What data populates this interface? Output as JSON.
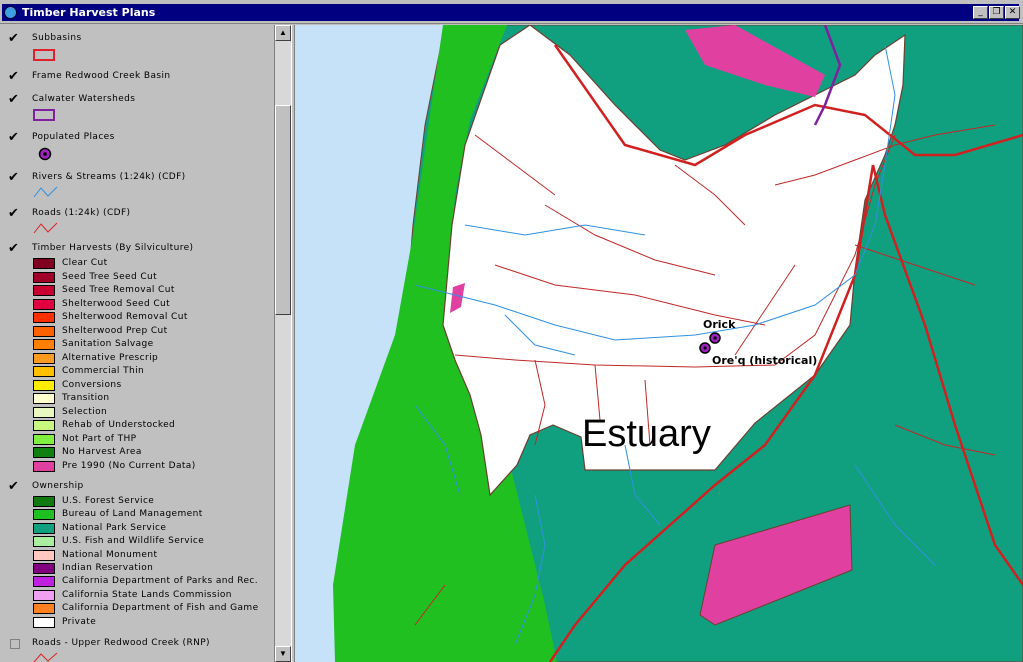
{
  "window": {
    "title": "Timber Harvest Plans",
    "min_label": "_",
    "restore_label": "❐",
    "close_label": "✕"
  },
  "legend": {
    "layers": [
      {
        "name": "Subbasins",
        "checked": true,
        "symbol": "box-outline",
        "color": "#e0202a"
      },
      {
        "name": "Frame Redwood Creek Basin",
        "checked": true
      },
      {
        "name": "Calwater Watersheds",
        "checked": true,
        "symbol": "box-outline",
        "color": "#8020a0"
      },
      {
        "name": "Populated Places",
        "checked": true,
        "symbol": "point",
        "color": "#a020c0"
      },
      {
        "name": "Rivers & Streams (1:24k) (CDF)",
        "checked": true,
        "symbol": "line",
        "color": "#3090e0"
      },
      {
        "name": "Roads (1:24k) (CDF)",
        "checked": true,
        "symbol": "line",
        "color": "#e02020"
      },
      {
        "name": "Timber Harvests (By Silviculture)",
        "checked": true
      },
      {
        "name": "Ownership",
        "checked": true
      },
      {
        "name": "Roads - Upper Redwood Creek (RNP)",
        "checked": false,
        "symbol": "line",
        "color": "#e02020"
      }
    ],
    "harvest_classes": [
      {
        "label": "Clear Cut",
        "color": "#800020"
      },
      {
        "label": "Seed Tree Seed Cut",
        "color": "#a00028"
      },
      {
        "label": "Seed Tree Removal Cut",
        "color": "#c80030"
      },
      {
        "label": "Shelterwood Seed Cut",
        "color": "#e00040"
      },
      {
        "label": "Shelterwood Removal Cut",
        "color": "#ff3000"
      },
      {
        "label": "Shelterwood Prep Cut",
        "color": "#ff6000"
      },
      {
        "label": "Sanitation Salvage",
        "color": "#ff8000"
      },
      {
        "label": "Alternative Prescrip",
        "color": "#ff9a20"
      },
      {
        "label": "Commercial Thin",
        "color": "#ffc000"
      },
      {
        "label": "Conversions",
        "color": "#ffee00"
      },
      {
        "label": "Transition",
        "color": "#ffffd0"
      },
      {
        "label": "Selection",
        "color": "#e8f8c0"
      },
      {
        "label": "Rehab of Understocked",
        "color": "#c8f880"
      },
      {
        "label": "Not Part of THP",
        "color": "#80f040"
      },
      {
        "label": "No Harvest Area",
        "color": "#108010"
      },
      {
        "label": "Pre 1990 (No Current Data)",
        "color": "#e040a0"
      }
    ],
    "ownership_classes": [
      {
        "label": "U.S. Forest Service",
        "color": "#107a10"
      },
      {
        "label": "Bureau of Land Management",
        "color": "#20c020"
      },
      {
        "label": "National Park Service",
        "color": "#10a080"
      },
      {
        "label": "U.S. Fish and Wildlife Service",
        "color": "#a8f0a0"
      },
      {
        "label": "National Monument",
        "color": "#ffc8c0"
      },
      {
        "label": "Indian Reservation",
        "color": "#800080"
      },
      {
        "label": "California Department of Parks and Rec.",
        "color": "#c020e0"
      },
      {
        "label": "California State Lands Commission",
        "color": "#f0a0f0"
      },
      {
        "label": "California Department of Fish and Game",
        "color": "#ff8020"
      },
      {
        "label": "Private",
        "color": "#ffffff"
      }
    ]
  },
  "map": {
    "places": [
      {
        "name": "Orick"
      },
      {
        "name": "Ore'q (historical)"
      }
    ],
    "area_label": "Estuary",
    "colors": {
      "ocean": "#c6e2f8",
      "park": "#10a080",
      "blm": "#20c020",
      "private": "#ffffff",
      "pre1990": "#e040a0",
      "road": "#e02020",
      "stream": "#3090e0",
      "subbasin": "#d02020"
    }
  }
}
